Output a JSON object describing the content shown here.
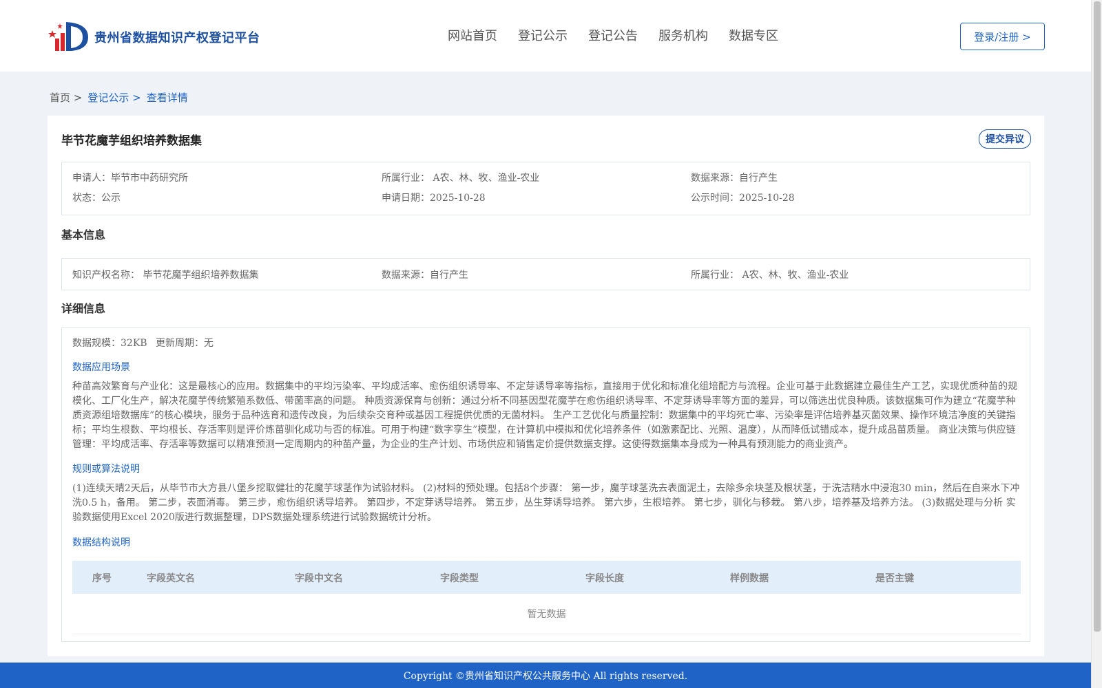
{
  "header": {
    "brand": "贵州省数据知识产权登记平台",
    "nav": [
      "网站首页",
      "登记公示",
      "登记公告",
      "服务机构",
      "数据专区"
    ],
    "login_label": "登录/注册 >"
  },
  "breadcrumb": {
    "home": "首页",
    "sep": ">",
    "publicity": "登记公示",
    "current": "查看详情"
  },
  "record": {
    "title": "毕节花魔芋组织培养数据集",
    "objection_label": "提交异议",
    "summary": {
      "applicant_label": "申请人：",
      "applicant": "毕节市中药研究所",
      "industry_label": "所属行业：",
      "industry": "A农、林、牧、渔业-农业",
      "source_label": "数据来源：",
      "source": "自行产生",
      "status_label": "状态：",
      "status": "公示",
      "apply_date_label": "申请日期：",
      "apply_date": "2025-10-28",
      "publicity_date_label": "公示时间：",
      "publicity_date": "2025-10-28"
    }
  },
  "basic_info": {
    "heading": "基本信息",
    "ip_name_label": "知识产权名称：",
    "ip_name": "毕节花魔芋组织培养数据集",
    "source_label": "数据来源：",
    "source": "自行产生",
    "industry_label": "所属行业：",
    "industry": "A农、林、牧、渔业-农业"
  },
  "detail_info": {
    "heading": "详细信息",
    "scale_label": "数据规模：",
    "scale": "32KB",
    "cycle_label": "更新周期：",
    "cycle": "无",
    "scenario_heading": "数据应用场景",
    "scenario_text": "种苗高效繁育与产业化：这是最核心的应用。数据集中的平均污染率、平均成活率、愈伤组织诱导率、不定芽诱导率等指标，直接用于优化和标准化组培配方与流程。企业可基于此数据建立最佳生产工艺，实现优质种苗的规模化、工厂化生产，解决花魔芋传统繁殖系数低、带菌率高的问题。 种质资源保育与创新：通过分析不同基因型花魔芋在愈伤组织诱导率、不定芽诱导率等方面的差异，可以筛选出优良种质。该数据集可作为建立“花魔芋种质资源组培数据库”的核心模块，服务于品种选育和遗传改良，为后续杂交育种或基因工程提供优质的无菌材料。 生产工艺优化与质量控制：数据集中的平均死亡率、污染率是评估培养基灭菌效果、操作环境洁净度的关键指标；平均生根数、平均根长、存活率则是评价炼苗驯化成功与否的标准。可用于构建“数字孪生”模型，在计算机中模拟和优化培养条件（如激素配比、光照、温度），从而降低试错成本，提升成品苗质量。 商业决策与供应链管理：平均成活率、存活率等数据可以精准预测一定周期内的种苗产量，为企业的生产计划、市场供应和销售定价提供数据支撑。这使得数据集本身成为一种具有预测能力的商业资产。",
    "algorithm_heading": "规则或算法说明",
    "algorithm_text": "(1)连续天晴2天后，从毕节市大方县八堡乡挖取健壮的花魔芋球茎作为试验材料。 (2)材料的预处理。包括8个步骤： 第一步，魔芋球茎洗去表面泥土，去除多余块茎及根状茎，于洗洁精水中浸泡30 min，然后在自来水下冲洗0.5 h，备用。 第二步，表面消毒。 第三步，愈伤组织诱导培养。 第四步，不定芽诱导培养。 第五步，丛生芽诱导培养。 第六步，生根培养。 第七步，驯化与移栽。 第八步，培养基及培养方法。 (3)数据处理与分析 实验数据使用Excel 2020版进行数据整理，DPS数据处理系统进行试验数据统计分析。",
    "structure_heading": "数据结构说明",
    "table": {
      "columns": [
        "序号",
        "字段英文名",
        "字段中文名",
        "字段类型",
        "字段长度",
        "样例数据",
        "是否主键"
      ],
      "empty_text": "暂无数据"
    }
  },
  "footer": {
    "copyright": "Copyright ©贵州省知识产权公共服务中心 All rights reserved."
  },
  "colors": {
    "brand": "#1e50a2",
    "link": "#1f63c6",
    "footer_bg": "#1f63c6",
    "table_head_bg": "#e3eefb",
    "page_bg": "#eff2f6"
  }
}
